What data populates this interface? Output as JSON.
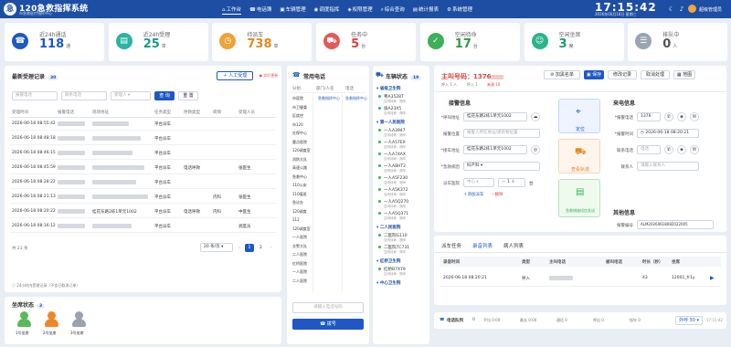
{
  "header": {
    "logo_char": "急",
    "title": "120急救指挥系统",
    "subtitle": "市急救医疗指挥中心",
    "nav": [
      {
        "label": "工作台",
        "icon": "⌂",
        "active": true
      },
      {
        "label": "电话簿",
        "icon": "☎",
        "active": false
      },
      {
        "label": "车辆管理",
        "icon": "▣",
        "active": false
      },
      {
        "label": "调度指挥",
        "icon": "◉",
        "active": false
      },
      {
        "label": "权限管理",
        "icon": "◈",
        "active": false
      },
      {
        "label": "综合查询",
        "icon": "⌕",
        "active": false
      },
      {
        "label": "统计报表",
        "icon": "▤",
        "active": false
      },
      {
        "label": "系统管理",
        "icon": "⚙",
        "active": false
      }
    ],
    "time": "17:15:42",
    "date": "2026年06月18日 星期三",
    "user": "超级管理员"
  },
  "stats": [
    {
      "label": "近24h通话",
      "value": "118",
      "unit": "通",
      "icon": "☎",
      "color": "#1d58c4",
      "value_color": "#1d58c4"
    },
    {
      "label": "近24h受理",
      "value": "25",
      "unit": "单",
      "icon": "▤",
      "color": "#2bb3a3",
      "value_color": "#1a9a8c"
    },
    {
      "label": "待派车",
      "value": "738",
      "unit": "单",
      "icon": "◷",
      "color": "#f0a23a",
      "value_color": "#e08a1e"
    },
    {
      "label": "任务中",
      "value": "5",
      "unit": "台",
      "icon": "⛟",
      "color": "#e25b5b",
      "value_color": "#d94343"
    },
    {
      "label": "空闲待命",
      "value": "17",
      "unit": "台",
      "icon": "✓",
      "color": "#3cb05a",
      "value_color": "#2d9a49"
    },
    {
      "label": "空闲坐席",
      "value": "3",
      "unit": "席",
      "icon": "☺",
      "color": "#2bb38a",
      "value_color": "#1a9a72"
    },
    {
      "label": "排队中",
      "value": "0",
      "unit": "人",
      "icon": "☰",
      "color": "#9aa3b2",
      "value_color": "#555"
    }
  ],
  "records": {
    "title": "最新受理记录",
    "count": "30",
    "btn_manual": "人工受理",
    "btn_recent": "实时更新",
    "filter_phone": "报警电话",
    "filter_caller": "联系电话",
    "filter_status": "受理人",
    "btn_search": "查 询",
    "btn_reset": "重 置",
    "columns": [
      "受理时间",
      "报警电话",
      "现场地址",
      "任务类型",
      "呼救类型",
      "病情",
      "受理人员"
    ],
    "rows": [
      {
        "time": "2026-06-18 08:55:42",
        "type": "平台派车",
        "kind": "",
        "cond": "",
        "staff": ""
      },
      {
        "time": "2026-06-18 08:48:18",
        "type": "平台派车",
        "kind": "",
        "cond": "",
        "staff": ""
      },
      {
        "time": "2026-06-18 08:46:15",
        "type": "平台派车",
        "kind": "",
        "cond": "",
        "staff": ""
      },
      {
        "time": "2026-06-18 08:45:59",
        "type": "平台派车",
        "kind": "电话呼救",
        "cond": "",
        "staff": "张医生"
      },
      {
        "time": "2026-06-18 08:28:22",
        "type": "平台派车",
        "kind": "",
        "cond": "",
        "staff": ""
      },
      {
        "time": "2026-06-18 08:21:13",
        "type": "平台派车",
        "kind": "",
        "cond": "内科",
        "staff": "张医生"
      },
      {
        "time": "2026-06-18 08:20:22",
        "type": "平台派车",
        "kind": "电话呼救",
        "cond": "内科",
        "staff": "中医生"
      },
      {
        "time": "2026-06-18 08:16:12",
        "type": "平台派车",
        "kind": "",
        "cond": "",
        "staff": "调度员"
      }
    ],
    "addr_visible": "桂花东路2栋1单元1002",
    "total": "共 23 条",
    "page_size": "20 条/页",
    "pages": [
      "1",
      "2"
    ],
    "footer_note": "24小时内受理记录（不含已取消订单）"
  },
  "seats": {
    "title": "坐席状态",
    "count": "3",
    "items": [
      {
        "label": "1号坐席",
        "color": "#5cb85c"
      },
      {
        "label": "2号坐席",
        "color": "#f0862a"
      },
      {
        "label": "3号坐席",
        "color": "#9aa3ad"
      }
    ]
  },
  "phones": {
    "title": "常用电话",
    "columns": [
      "分组",
      "部门/人名",
      "电话"
    ],
    "groups": [
      "市医院",
      "市卫健委",
      "区疾控",
      "市120",
      "社保中心",
      "重点医院",
      "120调度室",
      "消防大队",
      "高速公路",
      "急救中心",
      "110公安",
      "110值班",
      "急诊办",
      "120调度",
      "112",
      "120调度室",
      "一人医院",
      "交警大队",
      "二人医院",
      "红桥医院",
      "一人医院",
      "二人医院"
    ],
    "row1": [
      "急救指挥中心",
      "急救指挥中心"
    ],
    "search_placeholder": "请输入电话号码",
    "btn_dial": "拨号"
  },
  "vehicles": {
    "title": "车辆状态",
    "count": "19",
    "groups": [
      {
        "name": "省级卫生院",
        "items": [
          {
            "plate": "粤A3528T",
            "status": "空闲待命 · 随车"
          },
          {
            "plate": "渝A23X5",
            "status": "空闲待命 · 随车"
          }
        ]
      },
      {
        "name": "第一人民医院",
        "items": [
          {
            "plate": "一人A3947",
            "status": "空闲待命 · 随车"
          },
          {
            "plate": "一人A57EX",
            "status": "空闲待命 · 随车"
          },
          {
            "plate": "一人A74AX",
            "status": "空闲待命 · 随车"
          },
          {
            "plate": "一人A8HT2",
            "status": "空闲待命 · 随车"
          },
          {
            "plate": "一人A5F230",
            "status": "空闲待命 · 随车"
          },
          {
            "plate": "一人A5K372",
            "status": "空闲待命 · 随车"
          },
          {
            "plate": "一人A5Q270",
            "status": "空闲待命 · 随车"
          },
          {
            "plate": "一人A5Q371",
            "status": "空闲待命 · 随车"
          }
        ]
      },
      {
        "name": "二人民医院",
        "items": [
          {
            "plate": "二医院G110",
            "status": "空闲待命 · 随车"
          },
          {
            "plate": "二医院7C731",
            "status": "空闲待命 · 随车"
          }
        ]
      },
      {
        "name": "红桥卫生院",
        "items": [
          {
            "plate": "红桥B7X79",
            "status": "空闲待命 · 随车"
          }
        ]
      },
      {
        "name": "中心卫生院",
        "items": []
      }
    ]
  },
  "call": {
    "title": "主叫号码：",
    "number": "1376",
    "meta": [
      "呼入 1 人",
      "呼入 1",
      "来源 10"
    ],
    "buttons": [
      "加黑名单",
      "保存",
      "修改记录",
      "取消处理",
      "地图"
    ],
    "section_info": "接警信息",
    "f_addr_label": "呼叫地址",
    "f_addr": "桂花东路2栋1单元1002",
    "f_loc_label": "报警位置",
    "f_loc": "报警人所在地址/建筑物位置",
    "f_dest_label": "接车地址",
    "f_dest": "桂花东路2栋1单元1002",
    "f_hospital_label": "急救病因",
    "f_hospital": "妇产科",
    "f_sent_label": "派车医院",
    "f_sent_place": "中心",
    "f_sent_count": "1",
    "f_sent_unit": "台",
    "add_car": "添加派车",
    "remove_car": "删除",
    "btn_locate": "定位",
    "btn_map": "查看轨迹",
    "btn_notify": "急救措施短信发送",
    "section_caller": "来电信息",
    "c_phone_label": "报警电话",
    "c_phone": "1376",
    "c_time_label": "报警时间",
    "c_time": "2026-06-18 08:20:21",
    "c_contact_label": "联系电话",
    "c_contact": "电话",
    "c_name_label": "联系人",
    "c_name": "请输入联系人",
    "section_other": "其他信息",
    "o_code_label": "报警编号",
    "o_code": "ALM20260618082022005"
  },
  "recordings": {
    "tabs": [
      "派车任务",
      "录音列表",
      "病人列表"
    ],
    "active_tab": 1,
    "columns": [
      "录音时间",
      "类型",
      "主叫电话",
      "被叫电话",
      "时长（秒）",
      "坐席"
    ],
    "rows": [
      {
        "time": "2026-06-18 08:20:21",
        "type": "呼入",
        "caller": "",
        "called": "43",
        "dur": "43",
        "seat": "12001_fr1y"
      }
    ]
  },
  "footer": {
    "queue_label": "电话队列",
    "queue_count": "0",
    "items": [
      "平均 0:00",
      "最长 0:00",
      "通话 0",
      "呼出 0",
      "振铃 0"
    ],
    "dial_label": "外呼 30",
    "timestamp": "17:15:42"
  }
}
